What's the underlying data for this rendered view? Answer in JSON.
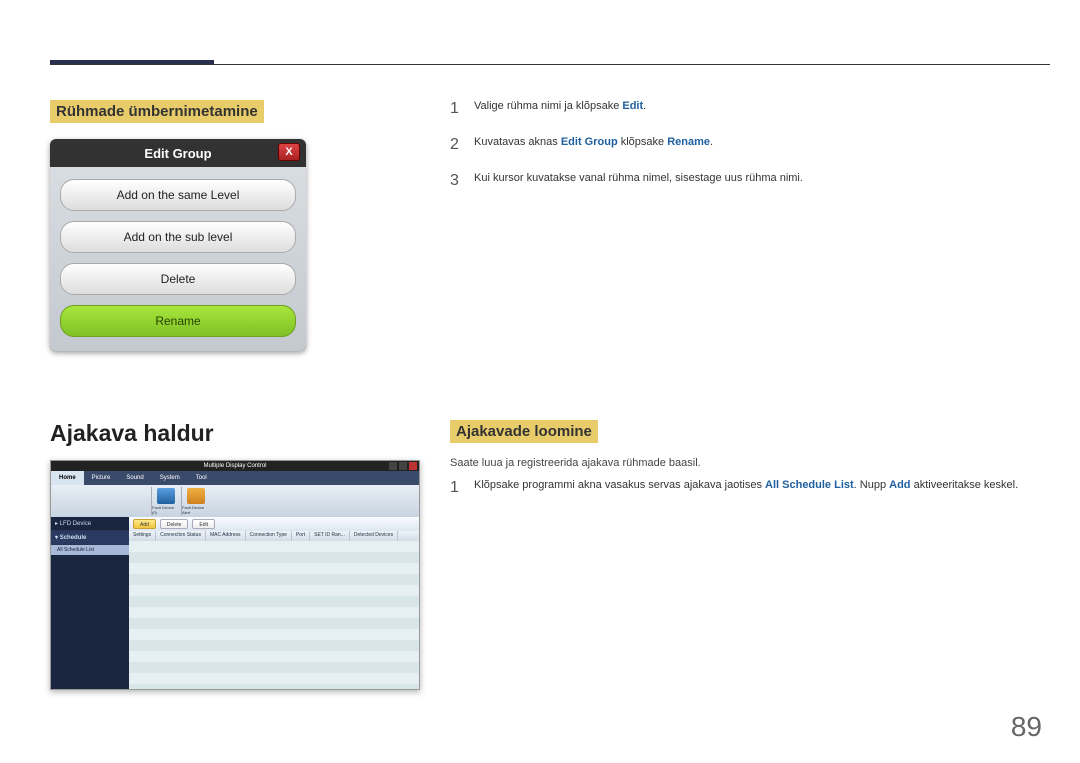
{
  "header": {},
  "left_top": {
    "title": "Rühmade ümbernimetamine",
    "window_title": "Edit Group",
    "close_label": "X",
    "buttons": [
      {
        "label": "Add on the same Level"
      },
      {
        "label": "Add on the sub level"
      },
      {
        "label": "Delete"
      },
      {
        "label": "Rename"
      }
    ]
  },
  "right_top": {
    "steps": [
      {
        "num": "1",
        "parts": [
          "Valige rühma nimi ja klõpsake ",
          "Edit",
          "."
        ]
      },
      {
        "num": "2",
        "parts": [
          "Kuvatavas aknas ",
          "Edit Group",
          " klõpsake ",
          "Rename",
          "."
        ]
      },
      {
        "num": "3",
        "parts": [
          "Kui kursor kuvatakse vanal rühma nimel, sisestage uus rühma nimi."
        ]
      }
    ]
  },
  "left_bottom": {
    "title": "Ajakava haldur",
    "window_title": "Multiple Display Control",
    "tabs": [
      "Home",
      "Picture",
      "Sound",
      "System",
      "Tool"
    ],
    "ribbon_items": [
      {
        "name": "Fault Device (0)"
      },
      {
        "name": "Fault Device Alert"
      }
    ],
    "sidebar": {
      "lfd": "LFD Device",
      "schedule": "Schedule",
      "all_list": "All Schedule List"
    },
    "toolbar": {
      "add": "Add",
      "delete": "Delete",
      "edit": "Edit"
    },
    "columns": [
      "Settings",
      "Connection Status",
      "MAC Address",
      "Connection Type",
      "Port",
      "SET ID Ran...",
      "Detected Devices"
    ]
  },
  "right_bottom": {
    "title": "Ajakavade loomine",
    "intro": "Saate luua ja registreerida ajakava rühmade baasil.",
    "steps": [
      {
        "num": "1",
        "parts": [
          "Klõpsake programmi akna vasakus servas ajakava jaotises ",
          "All Schedule List",
          ". Nupp ",
          "Add",
          " aktiveeritakse keskel."
        ]
      }
    ]
  },
  "page_number": "89"
}
